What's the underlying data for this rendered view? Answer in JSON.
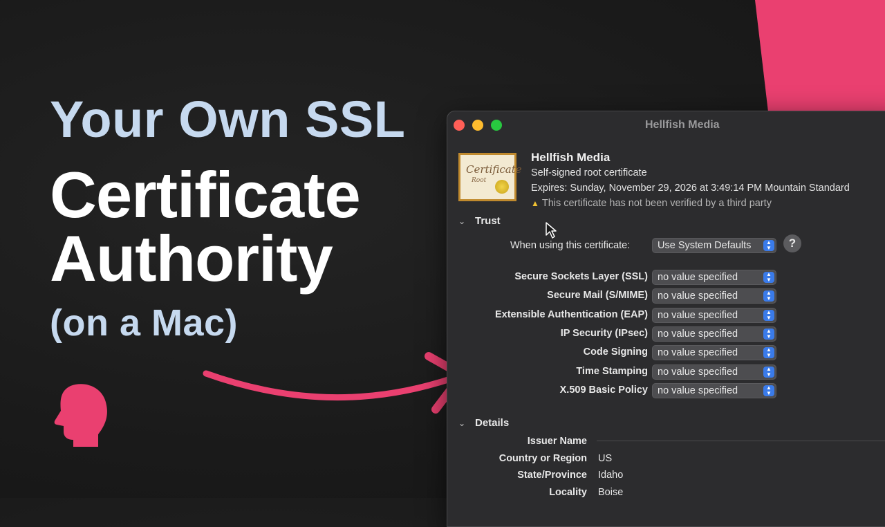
{
  "headline": {
    "line1_prefix": "Your Own ",
    "line1_accent": "SSL",
    "line2": "Certificate",
    "line3": "Authority",
    "line4": "(on a Mac)"
  },
  "colors": {
    "accent_pink": "#ea4070",
    "headline_light_blue": "#c6d9ef",
    "popup_stepper_blue": "#3a7bea"
  },
  "window": {
    "title": "Hellfish Media",
    "certificate": {
      "icon_text": "Certificate",
      "icon_subtext": "Root",
      "name": "Hellfish Media",
      "type": "Self-signed root certificate",
      "expires": "Expires: Sunday, November 29, 2026 at 3:49:14 PM Mountain Standard",
      "warning": "This certificate has not been verified by a third party"
    },
    "trust": {
      "section_label": "Trust",
      "when_using_label": "When using this certificate:",
      "when_using_value": "Use System Defaults",
      "help_label": "?",
      "policies": [
        {
          "label": "Secure Sockets Layer (SSL)",
          "value": "no value specified"
        },
        {
          "label": "Secure Mail (S/MIME)",
          "value": "no value specified"
        },
        {
          "label": "Extensible Authentication (EAP)",
          "value": "no value specified"
        },
        {
          "label": "IP Security (IPsec)",
          "value": "no value specified"
        },
        {
          "label": "Code Signing",
          "value": "no value specified"
        },
        {
          "label": "Time Stamping",
          "value": "no value specified"
        },
        {
          "label": "X.509 Basic Policy",
          "value": "no value specified"
        }
      ]
    },
    "details": {
      "section_label": "Details",
      "rows": [
        {
          "label": "Issuer Name",
          "value": ""
        },
        {
          "label": "Country or Region",
          "value": "US"
        },
        {
          "label": "State/Province",
          "value": "Idaho"
        },
        {
          "label": "Locality",
          "value": "Boise"
        }
      ]
    }
  }
}
